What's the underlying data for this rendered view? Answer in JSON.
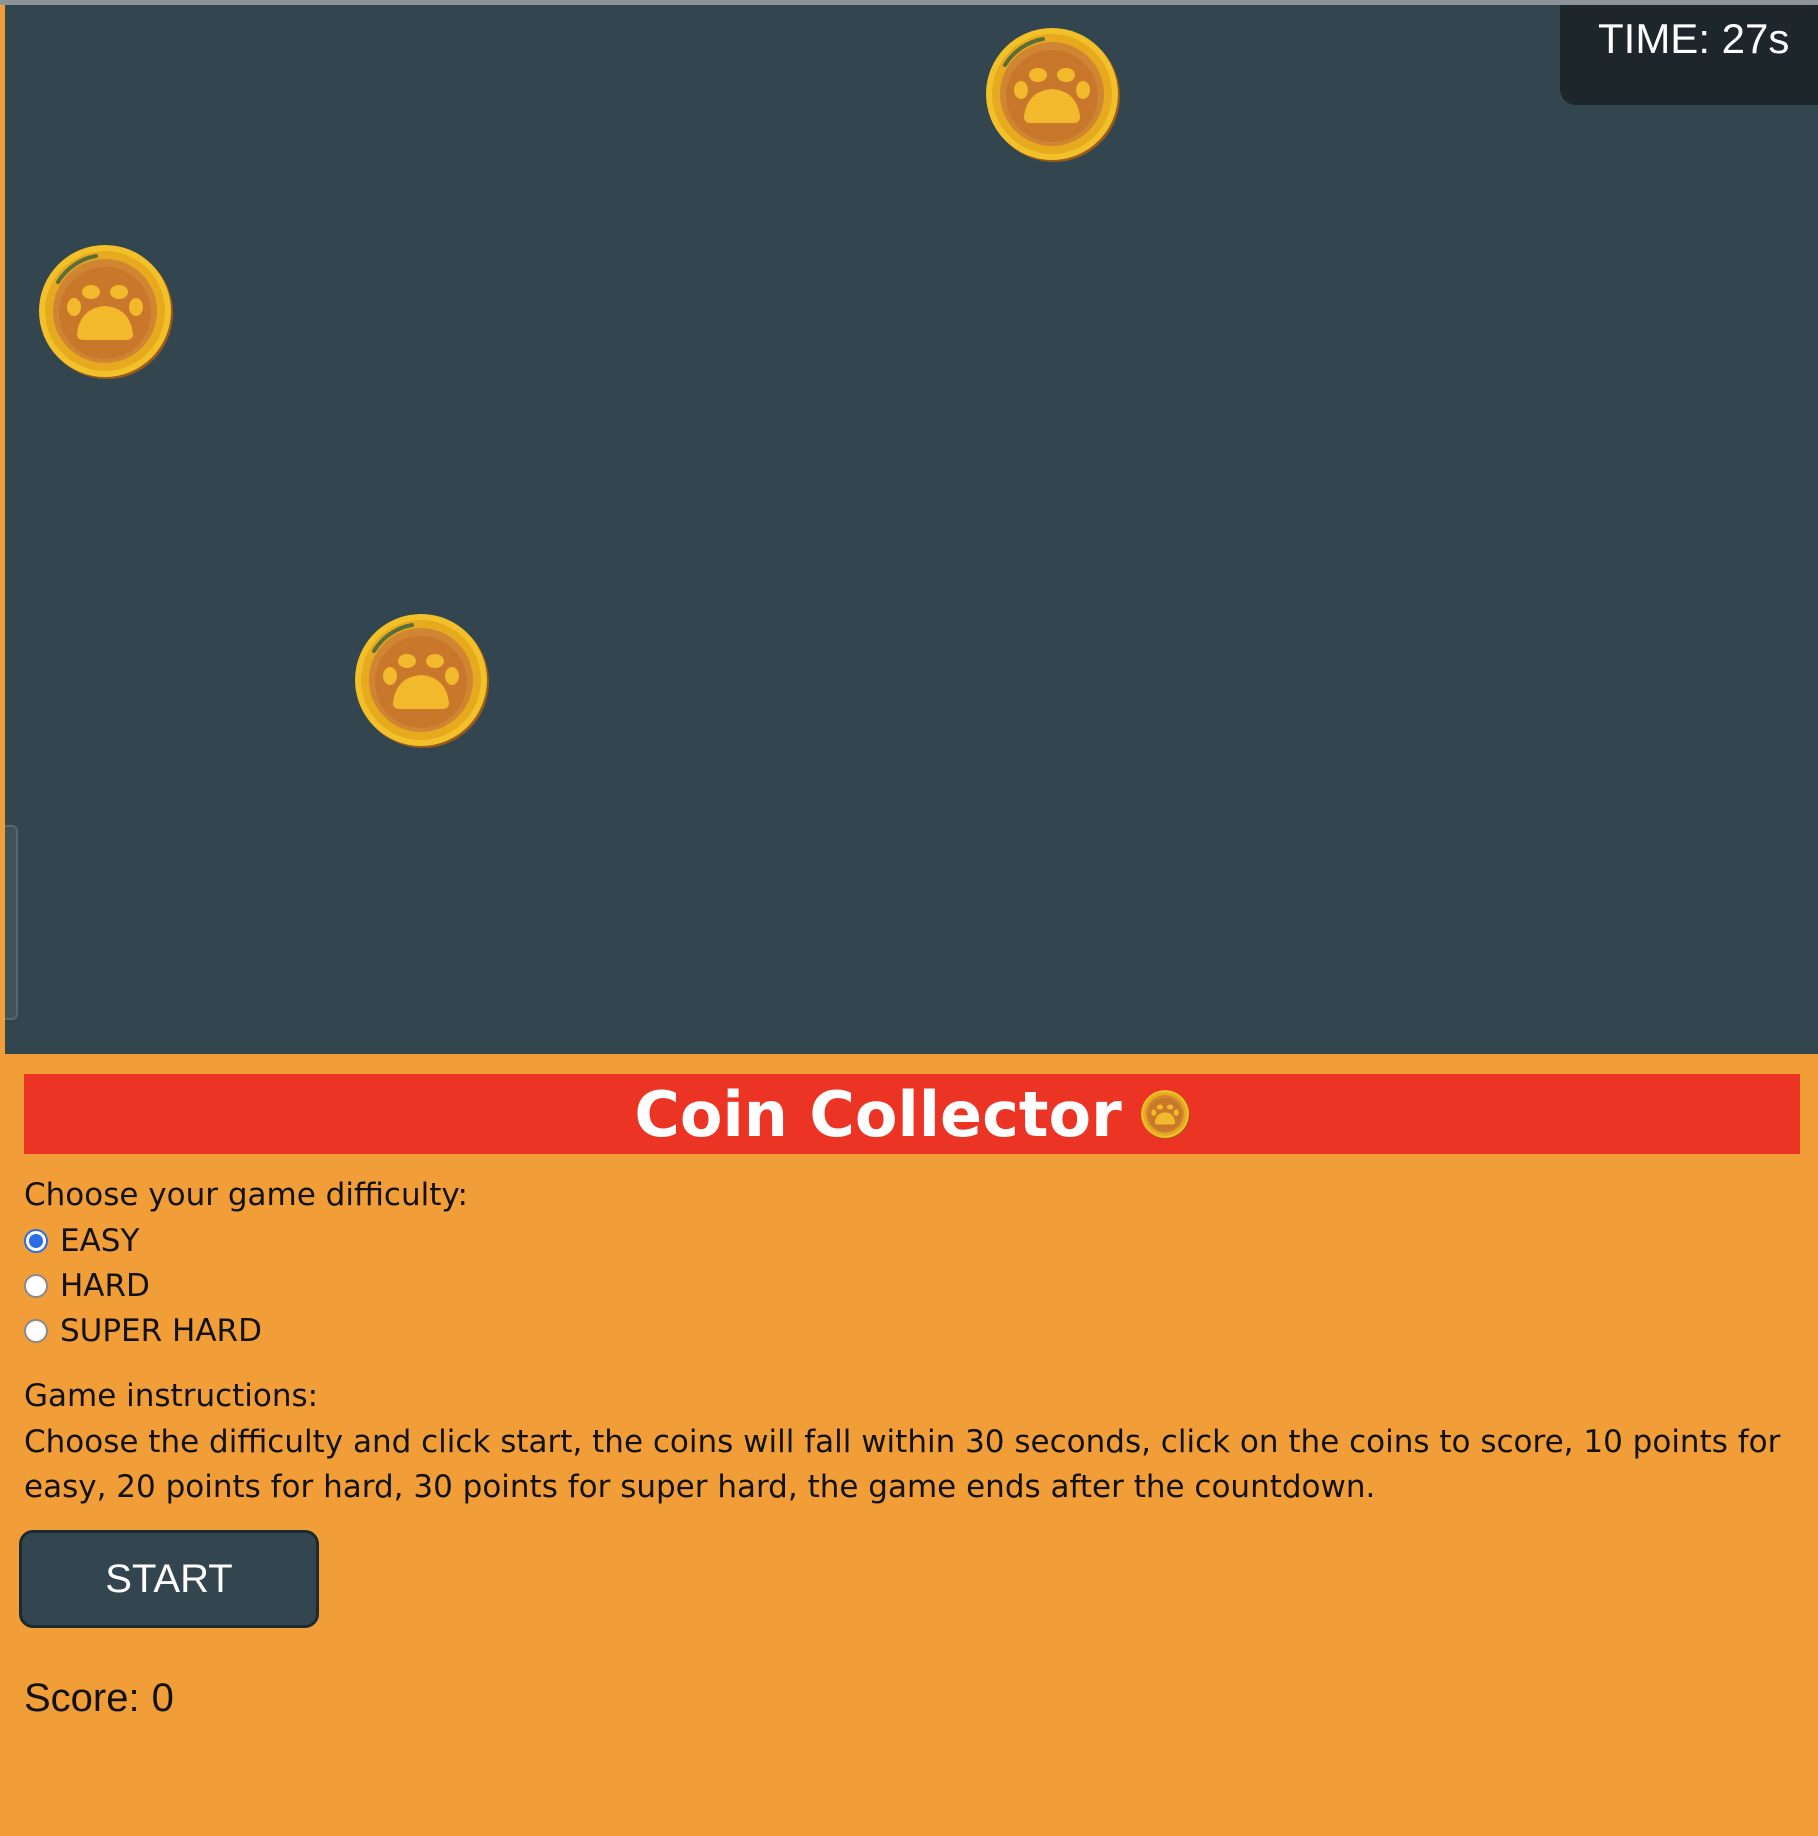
{
  "timer": {
    "label": "TIME:",
    "value": "27s"
  },
  "coins": [
    {
      "name": "falling-coin-1",
      "icon": "paw-coin-icon"
    },
    {
      "name": "falling-coin-2",
      "icon": "paw-coin-icon"
    },
    {
      "name": "falling-coin-3",
      "icon": "paw-coin-icon"
    }
  ],
  "panel": {
    "title": "Coin Collector",
    "title_icon": "paw-coin-icon",
    "difficulty_label": "Choose your game difficulty:",
    "difficulties": [
      {
        "label": "EASY",
        "selected": true
      },
      {
        "label": "HARD",
        "selected": false
      },
      {
        "label": "SUPER HARD",
        "selected": false
      }
    ],
    "instructions_label": "Game instructions:",
    "instructions_text": "Choose the difficulty and click start, the coins will fall within 30 seconds, click on the coins to score, 10 points for easy, 20 points for hard, 30 points for super hard, the game ends after the countdown.",
    "start_label": "START",
    "score_label": "Score:",
    "score_value": "0"
  },
  "colors": {
    "game_bg": "#33464f",
    "panel_bg": "#f29e38",
    "title_bg": "#ec3425",
    "timer_bg": "#1c262b",
    "button_bg": "#33464f",
    "radio_accent": "#2a6de9"
  }
}
